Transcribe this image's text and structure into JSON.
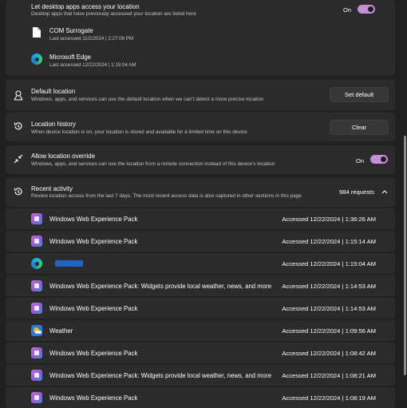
{
  "desktop_apps": {
    "title": "Let desktop apps access your location",
    "description": "Desktop apps that have previously accessed your location are listed here",
    "toggle_label": "On",
    "apps": [
      {
        "name": "COM Surrogate",
        "last_accessed": "Last accessed 11/2/2024  |  2:27:06 PM",
        "icon": "file-icon"
      },
      {
        "name": "Microsoft Edge",
        "last_accessed": "Last accessed 12/22/2024  |  1:15:04 AM",
        "icon": "edge-icon"
      }
    ]
  },
  "default_location": {
    "title": "Default location",
    "description": "Windows, apps, and services can use the default location when we can't detect a more precise location",
    "button": "Set default"
  },
  "location_history": {
    "title": "Location history",
    "description": "When device location is on, your location is stored and available for a limited time on this device",
    "button": "Clear"
  },
  "override": {
    "title": "Allow location override",
    "description": "Windows, apps, and services can use the location from a remote connection instead of this device's location",
    "toggle_label": "On"
  },
  "recent_activity": {
    "title": "Recent activity",
    "description": "Review location access from the last 7 days. The most recent access data is also captured in other sections in this page",
    "count": "984 requests",
    "items": [
      {
        "name": "Windows Web Experience Pack",
        "time": "Accessed 12/22/2024  |  1:36:26 AM",
        "icon": "wwep"
      },
      {
        "name": "Windows Web Experience Pack",
        "time": "Accessed 12/22/2024  |  1:15:14 AM",
        "icon": "wwep"
      },
      {
        "name": "",
        "time": "Accessed 12/22/2024  |  1:15:04 AM",
        "icon": "edge"
      },
      {
        "name": "Windows Web Experience Pack: Widgets provide local weather, news, and more",
        "time": "Accessed 12/22/2024  |  1:14:53 AM",
        "icon": "wwep"
      },
      {
        "name": "Windows Web Experience Pack",
        "time": "Accessed 12/22/2024  |  1:14:53 AM",
        "icon": "wwep"
      },
      {
        "name": "Weather",
        "time": "Accessed 12/22/2024  |  1:09:56 AM",
        "icon": "weather"
      },
      {
        "name": "Windows Web Experience Pack",
        "time": "Accessed 12/22/2024  |  1:08:42 AM",
        "icon": "wwep"
      },
      {
        "name": "Windows Web Experience Pack: Widgets provide local weather, news, and more",
        "time": "Accessed 12/22/2024  |  1:08:21 AM",
        "icon": "wwep"
      },
      {
        "name": "Windows Web Experience Pack",
        "time": "Accessed 12/22/2024  |  1:08:19 AM",
        "icon": "wwep"
      }
    ]
  }
}
